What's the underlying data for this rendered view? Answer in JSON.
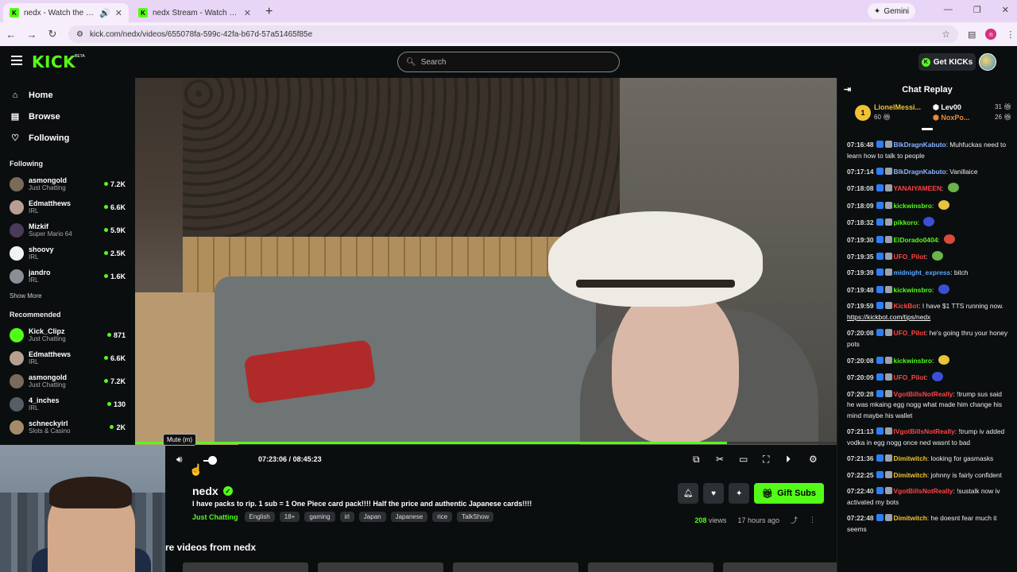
{
  "browser": {
    "tabs": [
      {
        "title": "nedx - Watch the VOD on Kick",
        "active": true
      },
      {
        "title": "nedx Stream - Watch Live on Kick",
        "active": false
      }
    ],
    "new_tab": "+",
    "gemini_label": "Gemini",
    "url": "kick.com/nedx/videos/655078fa-599c-42fa-b67d-57a51465f85e",
    "profile_initial": "n"
  },
  "header": {
    "logo": "KICK",
    "beta": "BETA",
    "search_placeholder": "Search",
    "get_kicks_label": "Get KICKs"
  },
  "sidebar": {
    "nav": [
      {
        "label": "Home",
        "icon": "home-icon"
      },
      {
        "label": "Browse",
        "icon": "browse-icon"
      },
      {
        "label": "Following",
        "icon": "heart-icon"
      }
    ],
    "following_title": "Following",
    "following": [
      {
        "name": "asmongold",
        "category": "Just Chatting",
        "viewers": "7.2K",
        "color": "#7a6a5a"
      },
      {
        "name": "Edmatthews",
        "category": "IRL",
        "viewers": "6.6K",
        "color": "#b7a091"
      },
      {
        "name": "Mizkif",
        "category": "Super Mario 64",
        "viewers": "5.9K",
        "color": "#4b3b5b"
      },
      {
        "name": "shoovy",
        "category": "IRL",
        "viewers": "2.5K",
        "color": "#f2f2f2"
      },
      {
        "name": "jandro",
        "category": "IRL",
        "viewers": "1.6K",
        "color": "#8a8f96"
      }
    ],
    "show_more": "Show More",
    "recommended_title": "Recommended",
    "recommended": [
      {
        "name": "Kick_Clipz",
        "category": "Just Chatting",
        "viewers": "871",
        "color": "#53fc18"
      },
      {
        "name": "Edmatthews",
        "category": "IRL",
        "viewers": "6.6K",
        "color": "#b7a091"
      },
      {
        "name": "asmongold",
        "category": "Just Chatting",
        "viewers": "7.2K",
        "color": "#7a6a5a"
      },
      {
        "name": "4_inches",
        "category": "IRL",
        "viewers": "130",
        "color": "#555d66"
      },
      {
        "name": "schneckyirl",
        "category": "Slots & Casino",
        "viewers": "2K",
        "color": "#a58b6b"
      }
    ]
  },
  "player": {
    "tooltip": "Mute (m)",
    "time_current": "07:23:06",
    "time_separator": "/",
    "time_total": "08:45:23",
    "progress_fraction": 0.844,
    "volume_fraction": 1.0
  },
  "stream": {
    "channel": "nedx",
    "title": "I have packs to rip. 1 sub = 1 One Piece card pack!!!! Half the price and authentic Japanese cards!!!!",
    "category": "Just Chatting",
    "tags": [
      "English",
      "18+",
      "gaming",
      "irl",
      "Japan",
      "Japanese",
      "rice",
      "TalkShow"
    ],
    "views_count": "208",
    "views_label": "views",
    "uploaded": "17 hours ago",
    "gift_label": "Gift Subs",
    "more_videos": "re videos from nedx"
  },
  "chat": {
    "title": "Chat Replay",
    "leaderboard": {
      "first": {
        "rank": "1",
        "name": "LionelMessi...",
        "value": "60"
      },
      "second": {
        "name": "Lev00",
        "value": "31"
      },
      "third": {
        "name": "NoxPo...",
        "value": "26"
      }
    },
    "messages": [
      {
        "time": "07:16:48",
        "user": "BlkDragnKabuto",
        "color": "#8ab4ff",
        "text": "Muhfuckas need to learn how to talk to people"
      },
      {
        "time": "07:17:14",
        "user": "BlkDragnKabuto",
        "color": "#8ab4ff",
        "text": "Vanillaice"
      },
      {
        "time": "07:18:08",
        "user": "YANAIYAMEEN",
        "color": "#ff4444",
        "text": ""
      },
      {
        "time": "07:18:09",
        "user": "kickwinsbro",
        "color": "#53fc18",
        "text": ""
      },
      {
        "time": "07:18:32",
        "user": "pikkoro",
        "color": "#53fc18",
        "text": ""
      },
      {
        "time": "07:19:30",
        "user": "ElDorado0404",
        "color": "#53fc18",
        "text": ""
      },
      {
        "time": "07:19:35",
        "user": "UFO_Pilot",
        "color": "#ff4444",
        "text": ""
      },
      {
        "time": "07:19:39",
        "user": "midnight_express",
        "color": "#5aa7ff",
        "text": "bitch"
      },
      {
        "time": "07:19:48",
        "user": "kickwinsbro",
        "color": "#53fc18",
        "text": ""
      },
      {
        "time": "07:19:59",
        "user": "KickBot",
        "color": "#ff4444",
        "text": "I have $1 TTS running now.",
        "link": "https://kickbot.com/tips/nedx"
      },
      {
        "time": "07:20:08",
        "user": "UFO_Pilot",
        "color": "#ff4444",
        "text": "he's going thru your honey pots"
      },
      {
        "time": "07:20:08",
        "user": "kickwinsbro",
        "color": "#53fc18",
        "text": ""
      },
      {
        "time": "07:20:09",
        "user": "UFO_Pilot",
        "color": "#ff4444",
        "text": ""
      },
      {
        "time": "07:20:28",
        "user": "VgotBillsNotReally",
        "color": "#ff4444",
        "text": "!trump sus said he was mkaing egg nogg what made him change his mind maybe his wallet"
      },
      {
        "time": "07:21:13",
        "user": "IVgotBillsNotReally",
        "color": "#ff4444",
        "text": "!trump iv added vodka in egg nogg once ned wasnt to bad"
      },
      {
        "time": "07:21:36",
        "user": "Dimitwitch",
        "color": "#f0c233",
        "text": "looking for gasmasks"
      },
      {
        "time": "07:22:25",
        "user": "Dimitwitch",
        "color": "#f0c233",
        "text": "johnny is fairly confident"
      },
      {
        "time": "07:22:40",
        "user": "VgotBillsNotReally",
        "color": "#ff4444",
        "text": "!sustalk now iv activated my bots"
      },
      {
        "time": "07:22:48",
        "user": "Dimitwitch",
        "color": "#f0c233",
        "text": "he doesnt fear much it seems"
      }
    ]
  }
}
